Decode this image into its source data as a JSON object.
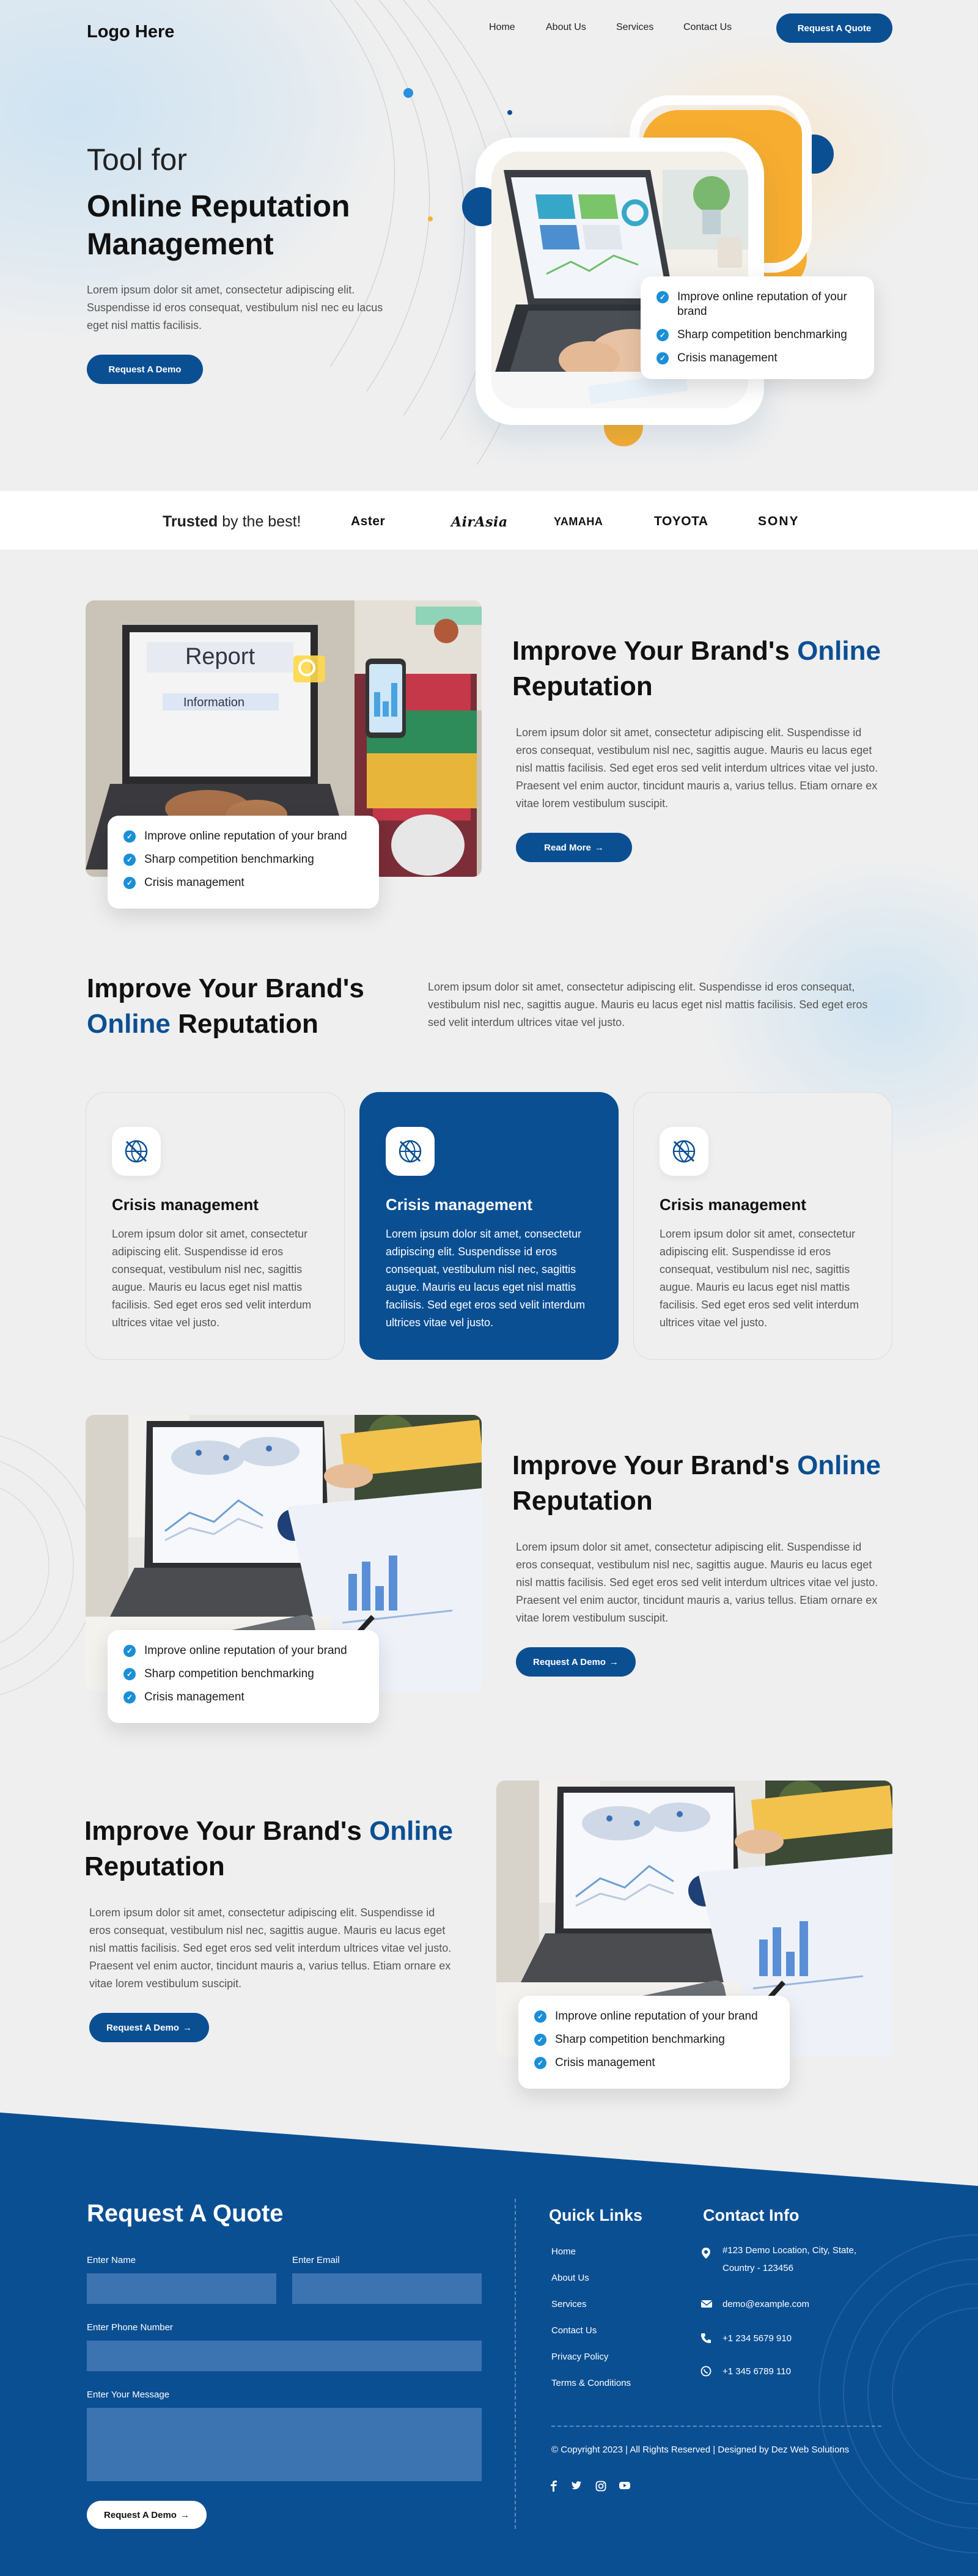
{
  "header": {
    "logo": "Logo Here",
    "nav": [
      "Home",
      "About Us",
      "Services",
      "Contact Us"
    ],
    "cta": "Request A Quote"
  },
  "hero": {
    "eyebrow": "Tool for",
    "title": "Online Reputation Management",
    "text": "Lorem ipsum dolor sit amet, consectetur adipiscing elit. Suspendisse id eros consequat, vestibulum nisl nec eu lacus eget nisl mattis facilisis.",
    "cta": "Request A Demo",
    "checklist": [
      "Improve online reputation of your brand",
      "Sharp competition benchmarking",
      "Crisis management"
    ]
  },
  "trusted": {
    "label_bold": "Trusted",
    "label_rest": " by the best!",
    "brands": [
      "Aster",
      "AirAsia",
      "YAMAHA",
      "TOYOTA",
      "SONY"
    ]
  },
  "feature1": {
    "title_a": "Improve Your Brand's ",
    "title_hl": "Online",
    "title_b": " Reputation",
    "text": "Lorem ipsum dolor sit amet, consectetur adipiscing elit. Suspendisse id eros consequat, vestibulum nisl nec, sagittis augue. Mauris eu lacus eget nisl mattis facilisis. Sed eget eros sed velit interdum ultrices vitae vel justo. Praesent vel enim auctor, tincidunt mauris a, varius tellus. Etiam ornare ex vitae lorem vestibulum suscipit.",
    "cta": "Read More",
    "checklist": [
      "Improve online reputation of your brand",
      "Sharp competition benchmarking",
      "Crisis management"
    ],
    "image": {
      "screen_word_1": "Report",
      "screen_word_2": "Information"
    }
  },
  "services": {
    "title_a": "Improve Your Brand's",
    "title_hl": "Online",
    "title_b": " Reputation",
    "text": "Lorem ipsum dolor sit amet, consectetur adipiscing elit. Suspendisse id eros consequat, vestibulum nisl nec, sagittis augue. Mauris eu lacus eget nisl mattis facilisis. Sed eget eros sed velit interdum ultrices vitae vel justo.",
    "cards": [
      {
        "icon": "globe-slash-icon",
        "title": "Crisis management",
        "text": "Lorem ipsum dolor sit amet, consectetur adipiscing elit. Suspendisse id eros consequat, vestibulum nisl nec, sagittis augue. Mauris eu lacus eget nisl mattis facilisis. Sed eget eros sed velit interdum ultrices vitae vel justo."
      },
      {
        "icon": "globe-slash-icon",
        "title": "Crisis management",
        "text": "Lorem ipsum dolor sit amet, consectetur adipiscing elit. Suspendisse id eros consequat, vestibulum nisl nec, sagittis augue. Mauris eu lacus eget nisl mattis facilisis. Sed eget eros sed velit interdum ultrices vitae vel justo."
      },
      {
        "icon": "globe-slash-icon",
        "title": "Crisis management",
        "text": "Lorem ipsum dolor sit amet, consectetur adipiscing elit. Suspendisse id eros consequat, vestibulum nisl nec, sagittis augue. Mauris eu lacus eget nisl mattis facilisis. Sed eget eros sed velit interdum ultrices vitae vel justo."
      }
    ]
  },
  "feature2": {
    "title_a": "Improve Your Brand's ",
    "title_hl": "Online",
    "title_b": " Reputation",
    "text": "Lorem ipsum dolor sit amet, consectetur adipiscing elit. Suspendisse id eros consequat, vestibulum nisl nec, sagittis augue. Mauris eu lacus eget nisl mattis facilisis. Sed eget eros sed velit interdum ultrices vitae vel justo. Praesent vel enim auctor, tincidunt mauris a, varius tellus. Etiam ornare ex vitae lorem vestibulum suscipit.",
    "cta": "Request A Demo",
    "checklist": [
      "Improve online reputation of your brand",
      "Sharp competition benchmarking",
      "Crisis management"
    ]
  },
  "feature3": {
    "title_a": "Improve Your Brand's ",
    "title_hl": "Online",
    "title_b": " Reputation",
    "text": "Lorem ipsum dolor sit amet, consectetur adipiscing elit. Suspendisse id eros consequat, vestibulum nisl nec, sagittis augue. Mauris eu lacus eget nisl mattis facilisis. Sed eget eros sed velit interdum ultrices vitae vel justo. Praesent vel enim auctor, tincidunt mauris a, varius tellus. Etiam ornare ex vitae lorem vestibulum suscipit.",
    "cta": "Request A Demo",
    "checklist": [
      "Improve online reputation of your brand",
      "Sharp competition benchmarking",
      "Crisis management"
    ]
  },
  "footer": {
    "quote_title": "Request A Quote",
    "name_label": "Enter Name",
    "email_label": "Enter Email",
    "phone_label": "Enter Phone Number",
    "message_label": "Enter Your Message",
    "submit": "Request A Demo",
    "links_title": "Quick Links",
    "links": [
      "Home",
      "About Us",
      "Services",
      "Contact Us",
      "Privacy Policy",
      "Terms & Conditions"
    ],
    "contact_title": "Contact Info",
    "address": "#123 Demo Location, City, State, Country - 123456",
    "email": "demo@example.com",
    "phone1": "+1 234 5679 910",
    "phone2": "+1 345 6789 110",
    "copyright": "© Copyright 2023  |  All Rights Reserved  |  Designed by Dez Web Solutions",
    "social": [
      "facebook-icon",
      "twitter-icon",
      "instagram-icon",
      "youtube-icon"
    ]
  },
  "colors": {
    "primary": "#0b4f93",
    "accent": "#f7ad2f",
    "check": "#1b8fd6",
    "page": "#efefef"
  }
}
